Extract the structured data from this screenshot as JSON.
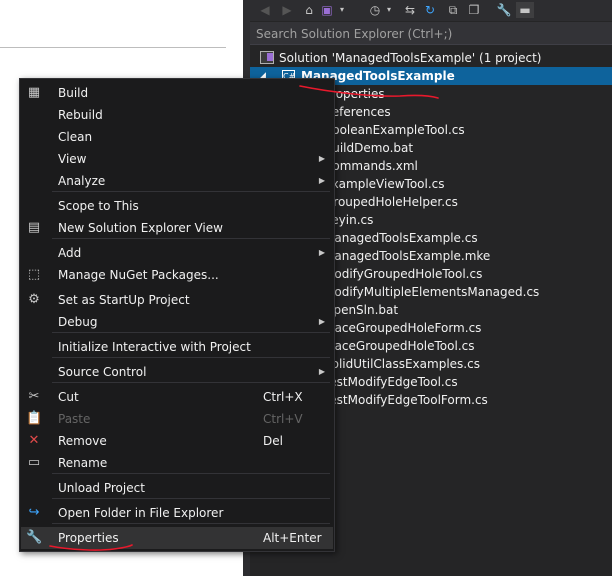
{
  "solution_explorer": {
    "search_placeholder": "Search Solution Explorer (Ctrl+;)",
    "solution_label": "Solution 'ManagedToolsExample' (1 project)",
    "project_label": "ManagedToolsExample",
    "project_icon_text": "C#",
    "files": [
      "Properties",
      "References",
      "BooleanExampleTool.cs",
      "BuildDemo.bat",
      "Commands.xml",
      "ExampleViewTool.cs",
      "GroupedHoleHelper.cs",
      "Keyin.cs",
      "ManagedToolsExample.cs",
      "ManagedToolsExample.mke",
      "ModifyGroupedHoleTool.cs",
      "ModifyMultipleElementsManaged.cs",
      "OpenSln.bat",
      "PlaceGroupedHoleForm.cs",
      "PlaceGroupedHoleTool.cs",
      "SolidUtilClassExamples.cs",
      "TestModifyEdgeTool.cs",
      "TestModifyEdgeToolForm.cs"
    ],
    "toolbar_icons": [
      "back-icon",
      "forward-icon",
      "home-icon",
      "vs-icon",
      "dropdown-icon",
      "history-icon",
      "dropdown-icon",
      "sync-icon",
      "refresh-icon",
      "collapse-all-icon",
      "show-all-files-icon",
      "properties-wrench-icon",
      "preview-icon"
    ]
  },
  "menu": {
    "items": [
      {
        "label": "Build",
        "icon": "build-icon",
        "shortcut": "",
        "submenu": false,
        "disabled": false
      },
      {
        "label": "Rebuild",
        "icon": "",
        "shortcut": "",
        "submenu": false,
        "disabled": false
      },
      {
        "label": "Clean",
        "icon": "",
        "shortcut": "",
        "submenu": false,
        "disabled": false
      },
      {
        "label": "View",
        "icon": "",
        "shortcut": "",
        "submenu": true,
        "disabled": false
      },
      {
        "label": "Analyze",
        "icon": "",
        "shortcut": "",
        "submenu": true,
        "disabled": false
      },
      {
        "label": "Scope to This",
        "icon": "",
        "shortcut": "",
        "submenu": false,
        "disabled": false
      },
      {
        "label": "New Solution Explorer View",
        "icon": "new-view-icon",
        "shortcut": "",
        "submenu": false,
        "disabled": false
      },
      {
        "label": "Add",
        "icon": "",
        "shortcut": "",
        "submenu": true,
        "disabled": false
      },
      {
        "label": "Manage NuGet Packages...",
        "icon": "nuget-icon",
        "shortcut": "",
        "submenu": false,
        "disabled": false
      },
      {
        "label": "Set as StartUp Project",
        "icon": "gear-icon",
        "shortcut": "",
        "submenu": false,
        "disabled": false
      },
      {
        "label": "Debug",
        "icon": "",
        "shortcut": "",
        "submenu": true,
        "disabled": false
      },
      {
        "label": "Initialize Interactive with Project",
        "icon": "",
        "shortcut": "",
        "submenu": false,
        "disabled": false
      },
      {
        "label": "Source Control",
        "icon": "",
        "shortcut": "",
        "submenu": true,
        "disabled": false
      },
      {
        "label": "Cut",
        "icon": "scissors-icon",
        "shortcut": "Ctrl+X",
        "submenu": false,
        "disabled": false
      },
      {
        "label": "Paste",
        "icon": "paste-icon",
        "shortcut": "Ctrl+V",
        "submenu": false,
        "disabled": true
      },
      {
        "label": "Remove",
        "icon": "remove-x-icon",
        "shortcut": "Del",
        "submenu": false,
        "disabled": false
      },
      {
        "label": "Rename",
        "icon": "rename-icon",
        "shortcut": "",
        "submenu": false,
        "disabled": false
      },
      {
        "label": "Unload Project",
        "icon": "",
        "shortcut": "",
        "submenu": false,
        "disabled": false
      },
      {
        "label": "Open Folder in File Explorer",
        "icon": "open-folder-icon",
        "shortcut": "",
        "submenu": false,
        "disabled": false
      },
      {
        "label": "Properties",
        "icon": "wrench-icon",
        "shortcut": "Alt+Enter",
        "submenu": false,
        "disabled": false,
        "highlighted": true
      }
    ]
  },
  "colors": {
    "selection": "#0e639c",
    "menu_bg": "#1b1b1c",
    "panel_bg": "#252526",
    "annotation_red": "#e8192c"
  }
}
